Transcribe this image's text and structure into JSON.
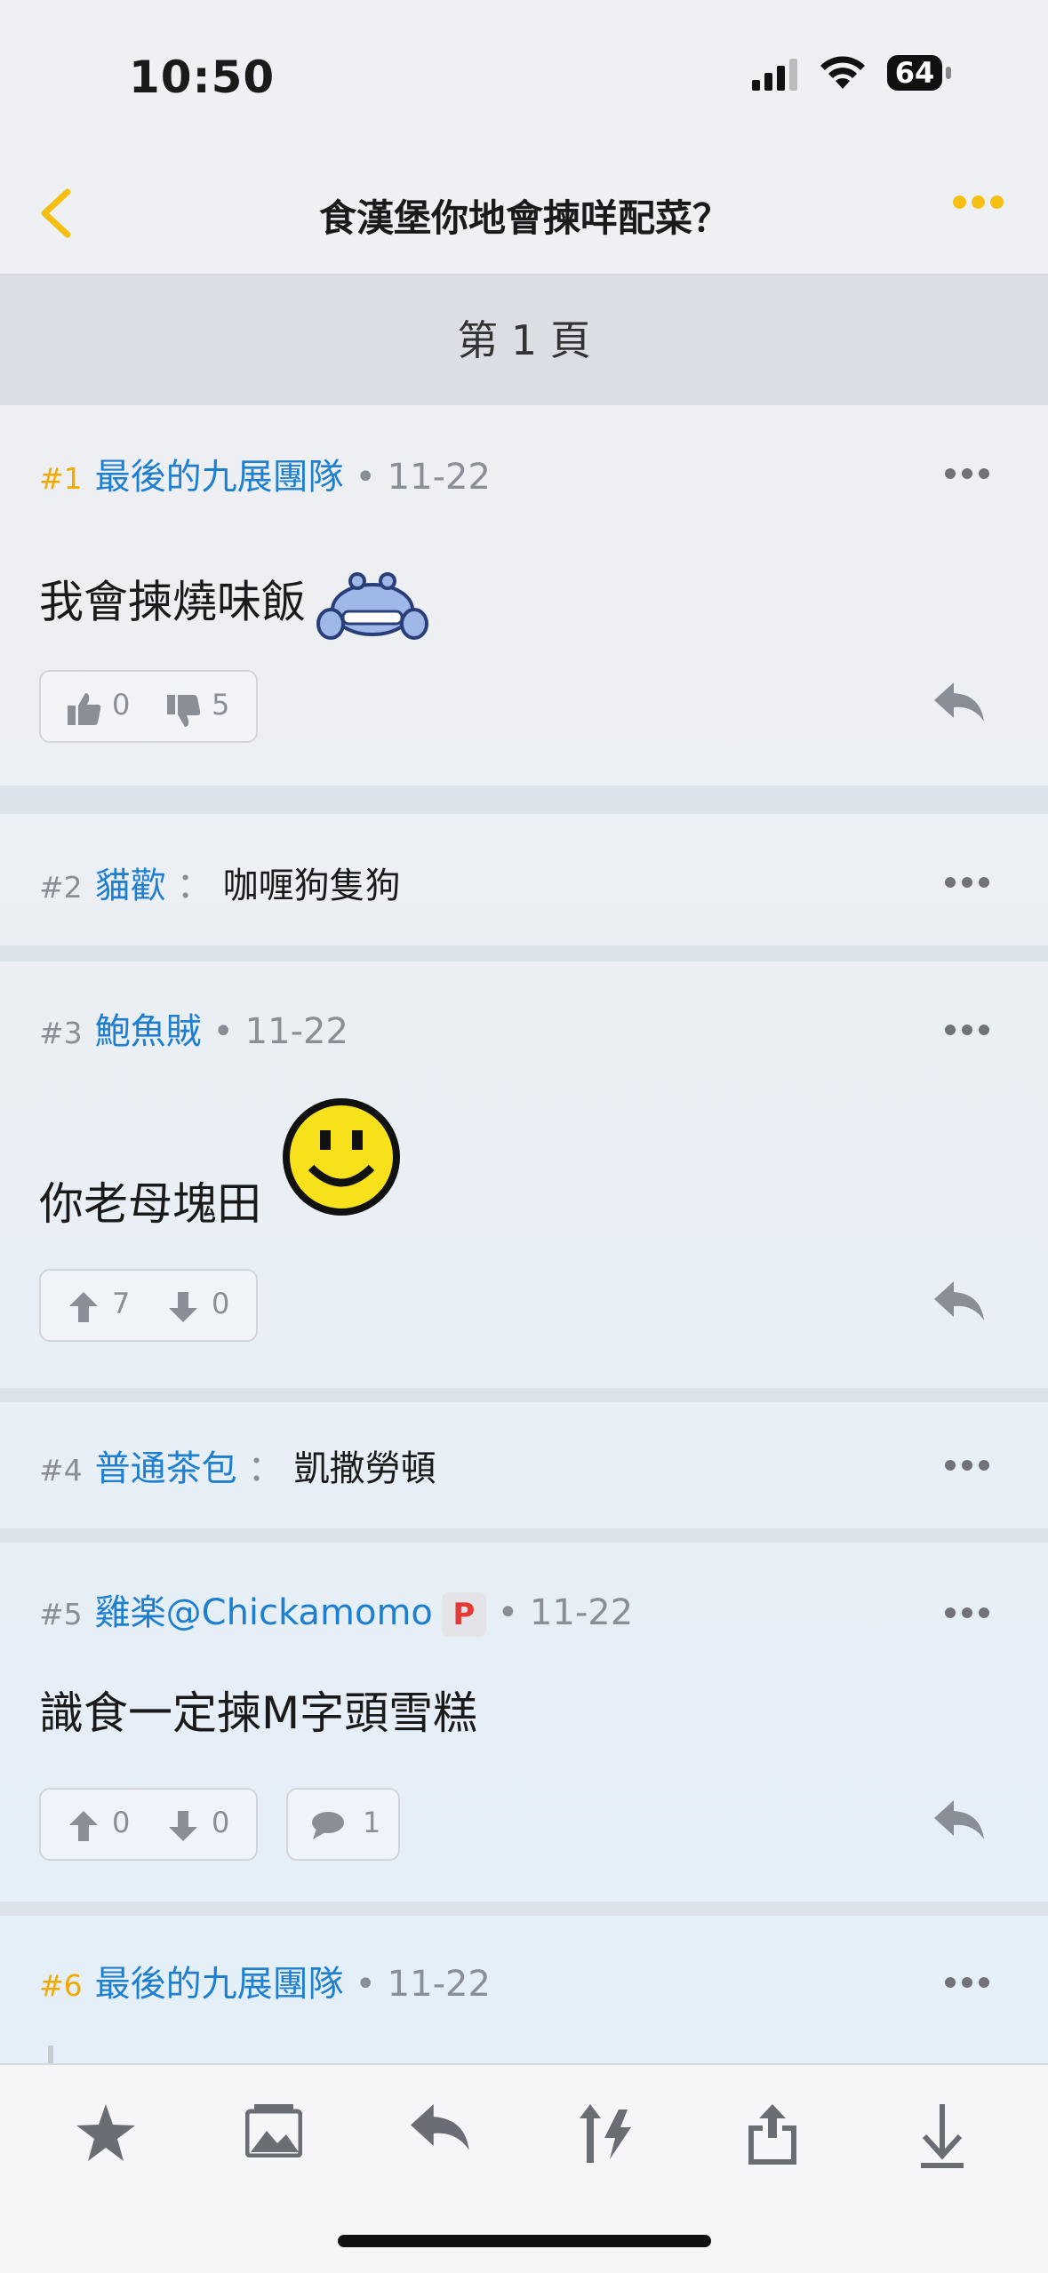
{
  "status_bar": {
    "time": "10:50",
    "battery": "64"
  },
  "nav": {
    "title": "食漢堡你地會揀咩配菜？"
  },
  "page_indicator": "第 1 頁",
  "posts": [
    {
      "num": "#1",
      "user": "最後的九展團隊",
      "date": "• 11-22",
      "text": "我會揀燒味飯",
      "likes": "0",
      "dislikes": "5"
    },
    {
      "num": "#2",
      "user": "貓歡",
      "colon": "：",
      "text": "咖喱狗隻狗"
    },
    {
      "num": "#3",
      "user": "鮑魚賊",
      "date": "• 11-22",
      "text": "你老母塊田",
      "up": "7",
      "down": "0"
    },
    {
      "num": "#4",
      "user": "普通茶包",
      "colon": "：",
      "text": "凱撒勞頓"
    },
    {
      "num": "#5",
      "user": "雞楽@Chickamomo",
      "badge": "P",
      "date": "• 11-22",
      "text": "識食一定揀M字頭雪糕",
      "up": "0",
      "down": "0",
      "comments": "1"
    },
    {
      "num": "#6",
      "user": "最後的九展團隊",
      "date": "• 11-22"
    }
  ],
  "icons": {
    "toolbar": [
      "star-icon",
      "image-icon",
      "reply-icon",
      "sort-icon",
      "share-icon",
      "download-icon"
    ]
  },
  "colors": {
    "accent": "#f5bf14",
    "user": "#1e7fd0"
  }
}
